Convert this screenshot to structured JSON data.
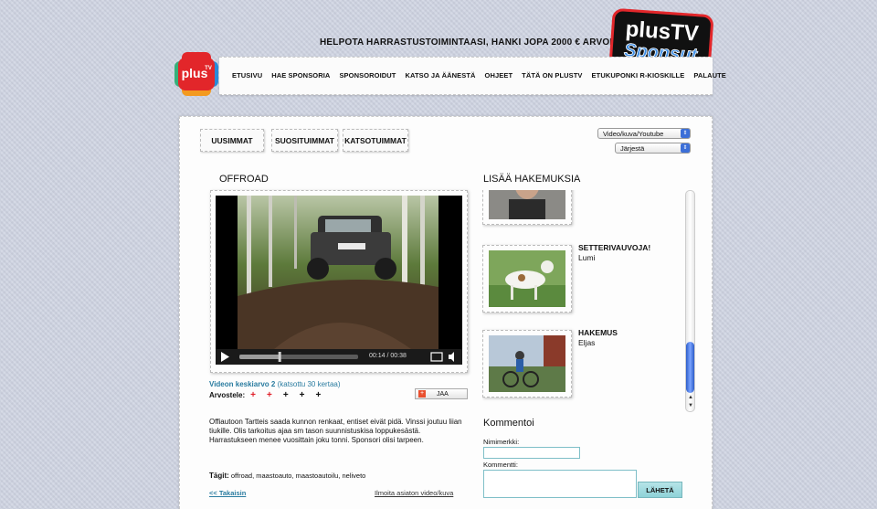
{
  "header": {
    "tagline": "HELPOTA HARRASTUSTOIMINTAASI, HANKI JOPA 2000 € ARVOINEN",
    "logo_big_line1": "plusTV",
    "logo_big_line2": "Sponsut",
    "logo_small": "plus",
    "logo_small_sup": "TV"
  },
  "nav": {
    "items": [
      {
        "label": "ETUSIVU"
      },
      {
        "label": "HAE SPONSORIA"
      },
      {
        "label": "SPONSOROIDUT"
      },
      {
        "label": "KATSO JA ÄÄNESTÄ"
      },
      {
        "label": "OHJEET"
      },
      {
        "label": "TÄTÄ ON PLUSTV"
      },
      {
        "label": "ETUKUPONKI R-KIOSKILLE"
      },
      {
        "label": "PALAUTE"
      }
    ]
  },
  "tabs": {
    "newest": "UUSIMMAT",
    "popular": "SUOSITUIMMAT",
    "most_viewed": "KATSOTUIMMAT"
  },
  "filters": {
    "media_select": "Video/kuva/Youtube",
    "sort_select": "Järjestä"
  },
  "video": {
    "title": "OFFROAD",
    "time": "00:14 / 00:38",
    "progress": 0.34,
    "rating_label": "Videon keskiarvo 2",
    "views": "(katsottu 30 kertaa)",
    "vote_label": "Arvostele:",
    "stars": [
      "+",
      "+",
      "+",
      "+",
      "+"
    ],
    "share_label": "JAA",
    "description": "Offiautoon Tartteis saada kunnon renkaat, entiset eivät pidä. Vinssi joutuu liian tiukille. Olis tarkoitus ajaa sm tason suunnistuskisa loppukesästä. Harrastukseen menee vuosittain joku tonni. Sponsori olisi tarpeen.",
    "tags_label": "Tägit:",
    "tags": "offroad, maastoauto, maastoautoilu, neliveto",
    "back_link": "<< Takaisin",
    "report_link": "Ilmoita asiaton video/kuva"
  },
  "more": {
    "title": "LISÄÄ HAKEMUKSIA",
    "items": [
      {
        "title": "",
        "user": ""
      },
      {
        "title": "SETTERIVAUVOJA!",
        "user": "Lumi"
      },
      {
        "title": "HAKEMUS",
        "user": "Eljas"
      }
    ]
  },
  "comments": {
    "title": "Kommentoi",
    "nickname_label": "Nimimerkki:",
    "comment_label": "Kommentti:",
    "send_label": "LÄHETÄ"
  },
  "colors": {
    "link": "#2a7ca0",
    "star_active": "#e0202a",
    "input_border": "#7fbfc8",
    "send_bg": "#9cd8dd",
    "scroll_thumb": "#3c6fd8"
  }
}
